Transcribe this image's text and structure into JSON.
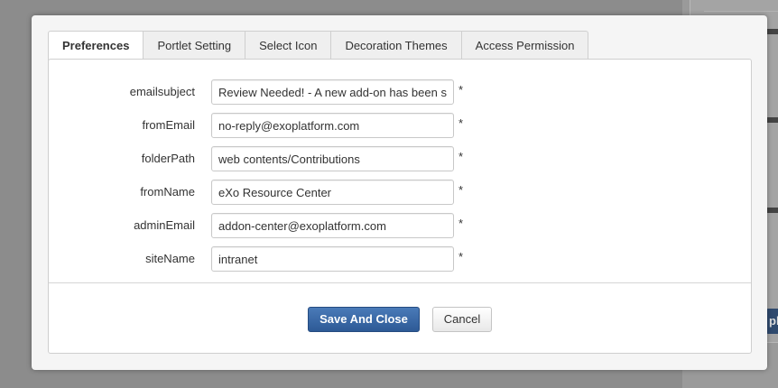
{
  "tabs": [
    {
      "label": "Preferences",
      "active": true
    },
    {
      "label": "Portlet Setting",
      "active": false
    },
    {
      "label": "Select Icon",
      "active": false
    },
    {
      "label": "Decoration Themes",
      "active": false
    },
    {
      "label": "Access Permission",
      "active": false
    }
  ],
  "fields": [
    {
      "label": "emailsubject",
      "value": "Review Needed! - A new add-on has been submitted",
      "required": "*"
    },
    {
      "label": "fromEmail",
      "value": "no-reply@exoplatform.com",
      "required": "*"
    },
    {
      "label": "folderPath",
      "value": "web contents/Contributions",
      "required": "*"
    },
    {
      "label": "fromName",
      "value": "eXo Resource Center",
      "required": "*"
    },
    {
      "label": "adminEmail",
      "value": "addon-center@exoplatform.com",
      "required": "*"
    },
    {
      "label": "siteName",
      "value": "intranet",
      "required": "*"
    }
  ],
  "actions": {
    "save_label": "Save And Close",
    "cancel_label": "Cancel"
  },
  "background": {
    "button_fragment": "pl"
  },
  "colors": {
    "primary": "#2d5a96",
    "overlay": "#8c8c8c",
    "modal_bg": "#f5f5f5"
  }
}
